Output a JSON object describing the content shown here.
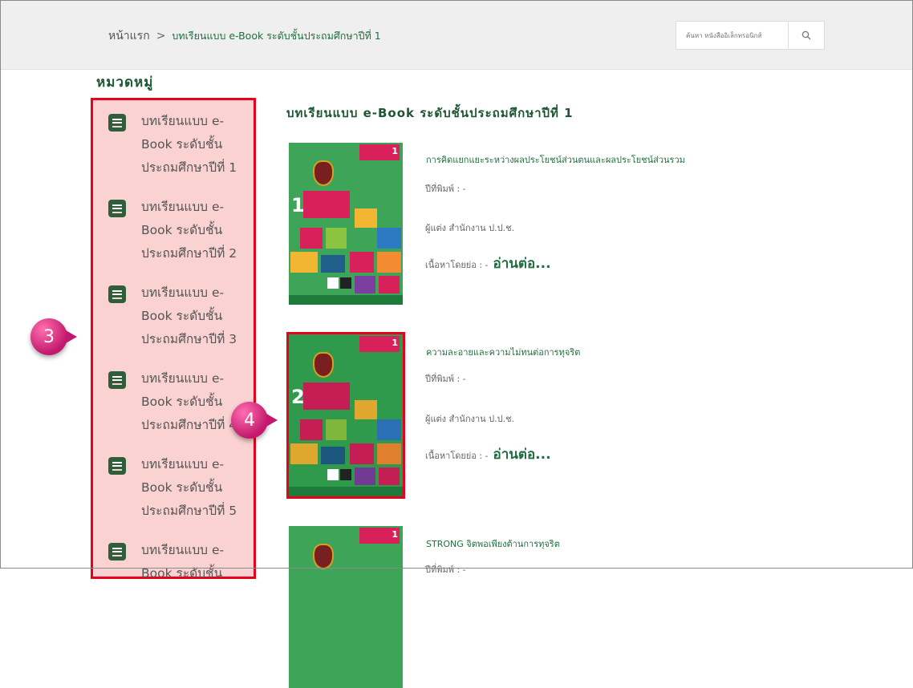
{
  "breadcrumb": {
    "home": "หน้าแรก",
    "separator": ">",
    "current": "บทเรียนแบบ e-Book ระดับชั้นประถมศึกษาปีที่ 1"
  },
  "search": {
    "placeholder": "ค้นหา หนังสืออิเล็กทรอนิกส์",
    "icon": "search-icon"
  },
  "categories": {
    "heading": "หมวดหมู่",
    "items": [
      {
        "label": "บทเรียนแบบ e-Book ระดับชั้นประถมศึกษาปีที่ 1"
      },
      {
        "label": "บทเรียนแบบ e-Book ระดับชั้นประถมศึกษาปีที่ 2"
      },
      {
        "label": "บทเรียนแบบ e-Book ระดับชั้นประถมศึกษาปีที่ 3"
      },
      {
        "label": "บทเรียนแบบ e-Book ระดับชั้นประถมศึกษาปีที่ 4"
      },
      {
        "label": "บทเรียนแบบ e-Book ระดับชั้นประถมศึกษาปีที่ 5"
      },
      {
        "label": "บทเรียนแบบ e-Book ระดับชั้น"
      }
    ]
  },
  "main": {
    "title": "บทเรียนแบบ e-Book ระดับชั้นประถมศึกษาปีที่ 1",
    "books": [
      {
        "title": "การคิดแยกแยะระหว่างผลประโยชน์ส่วนตนและผลประโยชน์ส่วนรวม",
        "year": "ปีที่พิมพ์ : -",
        "author": "ผู้แต่ง สำนักงาน ป.ป.ช.",
        "summary": "เนื้อหาโดยย่อ : -",
        "more": "อ่านต่อ...",
        "cover_number": "1",
        "cover_grade": "1"
      },
      {
        "title": "ความละอายและความไม่ทนต่อการทุจริต",
        "year": "ปีที่พิมพ์ : -",
        "author": "ผู้แต่ง สำนักงาน ป.ป.ช.",
        "summary": "เนื้อหาโดยย่อ : -",
        "more": "อ่านต่อ...",
        "cover_number": "2",
        "cover_grade": "1"
      },
      {
        "title": "STRONG จิตพอเพียงต้านการทุจริต",
        "year": "ปีที่พิมพ์ : -",
        "cover_grade": "1"
      }
    ]
  },
  "annotations": [
    "3",
    "4"
  ],
  "colors": {
    "accent": "#1e5632",
    "highlight": "#e8001c",
    "badge": "#c2186d"
  }
}
